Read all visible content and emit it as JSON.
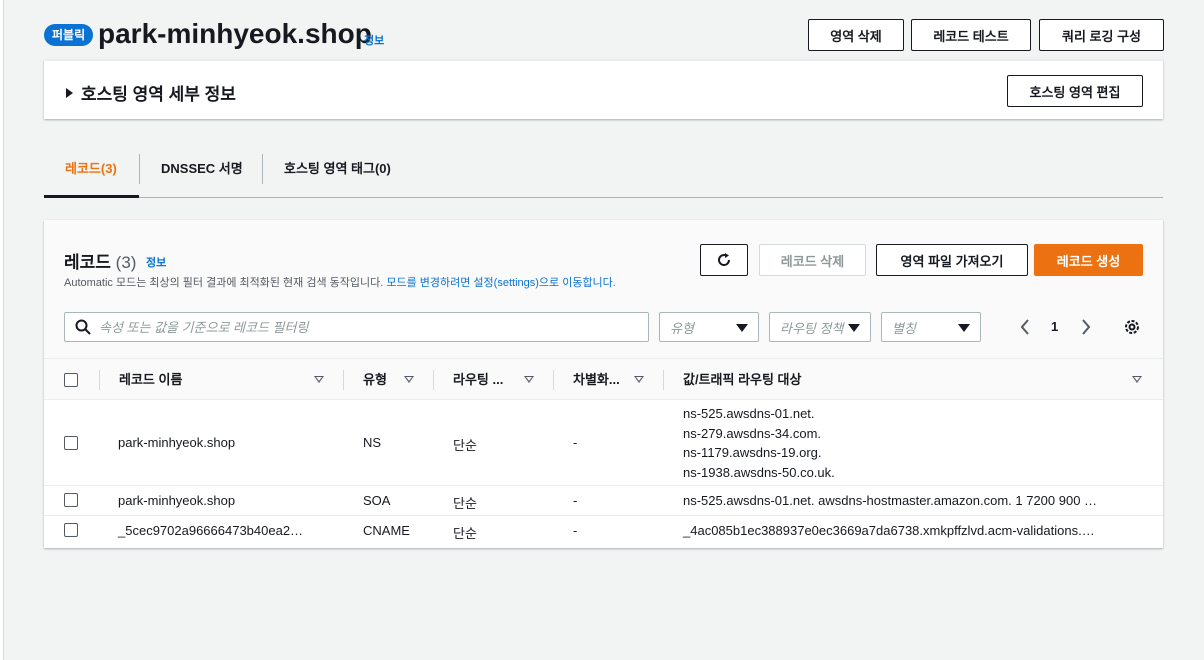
{
  "header": {
    "badge": "퍼블릭",
    "title": "park-minhyeok.shop",
    "info": "정보",
    "buttons": {
      "delete_zone": "영역 삭제",
      "test_record": "레코드 테스트",
      "query_logging": "쿼리 로깅 구성"
    }
  },
  "details": {
    "title": "호스팅 영역 세부 정보",
    "edit_button": "호스팅 영역 편집"
  },
  "tabs": [
    {
      "label": "레코드(3)",
      "active": true
    },
    {
      "label": "DNSSEC 서명",
      "active": false
    },
    {
      "label": "호스팅 영역 태그(0)",
      "active": false
    }
  ],
  "records": {
    "title": "레코드",
    "count": "(3)",
    "info": "정보",
    "desc_text": "Automatic 모드는 최상의 필터 결과에 최적화된 현재 검색 동작입니다. ",
    "desc_link": "모드를 변경하려면 설정(settings)으로 이동합니다.",
    "buttons": {
      "delete": "레코드 삭제",
      "import": "영역 파일 가져오기",
      "create": "레코드 생성"
    },
    "search_placeholder": "속성 또는 값을 기준으로 레코드 필터링",
    "filters": {
      "type": "유형",
      "routing_policy": "라우팅 정책",
      "alias": "별칭"
    },
    "pager": {
      "page": "1"
    },
    "columns": {
      "name": "레코드 이름",
      "type": "유형",
      "routing": "라우팅 ...",
      "differentiator": "차별화...",
      "value": "값/트래픽 라우팅 대상"
    },
    "rows": [
      {
        "name": "park-minhyeok.shop",
        "type": "NS",
        "routing": "단순",
        "diff": "-",
        "values": [
          "ns-525.awsdns-01.net.",
          "ns-279.awsdns-34.com.",
          "ns-1179.awsdns-19.org.",
          "ns-1938.awsdns-50.co.uk."
        ]
      },
      {
        "name": "park-minhyeok.shop",
        "type": "SOA",
        "routing": "단순",
        "diff": "-",
        "values": [
          "ns-525.awsdns-01.net. awsdns-hostmaster.amazon.com. 1 7200 900 …"
        ]
      },
      {
        "name": "_5cec9702a96666473b40ea2…",
        "type": "CNAME",
        "routing": "단순",
        "diff": "-",
        "values": [
          "_4ac085b1ec388937e0ec3669a7da6738.xmkpffzlvd.acm-validations.…"
        ]
      }
    ]
  },
  "colors": {
    "accent": "#ec7211",
    "link": "#0972d3",
    "badge": "#0972d3"
  },
  "icons": [
    "refresh-icon",
    "search-icon",
    "gear-icon",
    "chevron-left-icon",
    "chevron-right-icon",
    "caret-right-icon",
    "sort-down-icon",
    "dropdown-arrow-icon"
  ]
}
